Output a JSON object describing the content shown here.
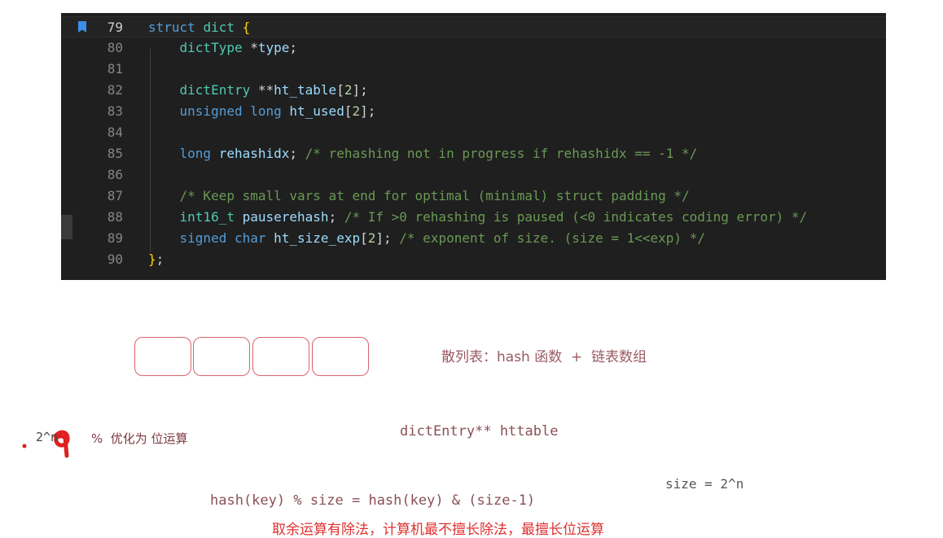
{
  "editor": {
    "lines": [
      {
        "num": "79",
        "tokens": [
          [
            "kw",
            "struct "
          ],
          [
            "ty",
            "dict "
          ],
          [
            "brace",
            "{"
          ]
        ]
      },
      {
        "num": "80",
        "tokens": [
          [
            "pl",
            "    "
          ],
          [
            "ty",
            "dictType "
          ],
          [
            "pl",
            "*"
          ],
          [
            "var",
            "type"
          ],
          [
            "pl",
            ";"
          ]
        ]
      },
      {
        "num": "81",
        "tokens": []
      },
      {
        "num": "82",
        "tokens": [
          [
            "pl",
            "    "
          ],
          [
            "ty",
            "dictEntry "
          ],
          [
            "pl",
            "**"
          ],
          [
            "var",
            "ht_table"
          ],
          [
            "pl",
            "["
          ],
          [
            "num",
            "2"
          ],
          [
            "pl",
            "];"
          ]
        ]
      },
      {
        "num": "83",
        "tokens": [
          [
            "pl",
            "    "
          ],
          [
            "kw",
            "unsigned long "
          ],
          [
            "var",
            "ht_used"
          ],
          [
            "pl",
            "["
          ],
          [
            "num",
            "2"
          ],
          [
            "pl",
            "];"
          ]
        ]
      },
      {
        "num": "84",
        "tokens": []
      },
      {
        "num": "85",
        "tokens": [
          [
            "pl",
            "    "
          ],
          [
            "kw",
            "long "
          ],
          [
            "var",
            "rehashidx"
          ],
          [
            "pl",
            "; "
          ],
          [
            "cm",
            "/* rehashing not in progress if rehashidx == -1 */"
          ]
        ]
      },
      {
        "num": "86",
        "tokens": []
      },
      {
        "num": "87",
        "tokens": [
          [
            "pl",
            "    "
          ],
          [
            "cm",
            "/* Keep small vars at end for optimal (minimal) struct padding */"
          ]
        ]
      },
      {
        "num": "88",
        "tokens": [
          [
            "pl",
            "    "
          ],
          [
            "ty",
            "int16_t "
          ],
          [
            "var",
            "pauserehash"
          ],
          [
            "pl",
            "; "
          ],
          [
            "cm",
            "/* If >0 rehashing is paused (<0 indicates coding error) */"
          ]
        ]
      },
      {
        "num": "89",
        "tokens": [
          [
            "pl",
            "    "
          ],
          [
            "kw",
            "signed char "
          ],
          [
            "var",
            "ht_size_exp"
          ],
          [
            "pl",
            "["
          ],
          [
            "num",
            "2"
          ],
          [
            "pl",
            "]; "
          ],
          [
            "cm",
            "/* exponent of size. (size = 1<<exp) */"
          ]
        ]
      },
      {
        "num": "90",
        "tokens": [
          [
            "brace",
            "}"
          ],
          [
            "pl",
            ";"
          ]
        ]
      }
    ]
  },
  "notes": {
    "hash_table_label": "散列表：hash 函数  +  链表数组",
    "dict_entry_label": "dictEntry** httable",
    "modulo_label": "%  优化为 位运算",
    "power_label": "2^n",
    "size_label": "size = 2^n",
    "formula": "hash(key) % size = hash(key) & (size-1)",
    "explanation": "取余运算有除法，计算机最不擅长除法，最擅长位运算"
  }
}
